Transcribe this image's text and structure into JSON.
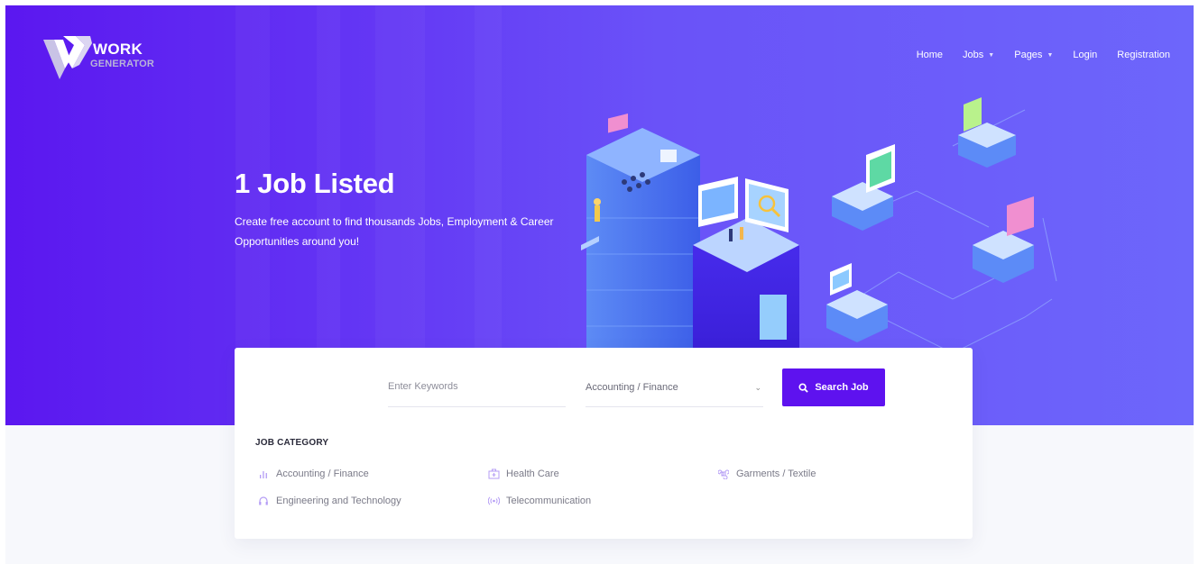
{
  "brand": {
    "line1": "WORK",
    "line2": "GENERATOR"
  },
  "nav": [
    {
      "label": "Home",
      "dropdown": false
    },
    {
      "label": "Jobs",
      "dropdown": true
    },
    {
      "label": "Pages",
      "dropdown": true
    },
    {
      "label": "Login",
      "dropdown": false
    },
    {
      "label": "Registration",
      "dropdown": false
    }
  ],
  "hero": {
    "title": "1 Job Listed",
    "subtitle": "Create free account to find thousands Jobs, Employment & Career Opportunities around you!"
  },
  "search": {
    "keyword_placeholder": "Enter Keywords",
    "keyword_value": "",
    "category_selected": "Accounting / Finance",
    "button_label": "Search Job"
  },
  "categories": {
    "heading": "JOB CATEGORY",
    "items": [
      {
        "label": "Accounting / Finance",
        "icon": "bar-chart-icon"
      },
      {
        "label": "Health Care",
        "icon": "medical-kit-icon"
      },
      {
        "label": "Garments / Textile",
        "icon": "command-icon"
      },
      {
        "label": "Engineering and Technology",
        "icon": "headphones-icon"
      },
      {
        "label": "Telecommunication",
        "icon": "broadcast-icon"
      }
    ]
  },
  "colors": {
    "brand_purple": "#5e12ef",
    "hero_start": "#5b17f0",
    "hero_end": "#6d66fb",
    "category_icon": "#b49cf5"
  }
}
